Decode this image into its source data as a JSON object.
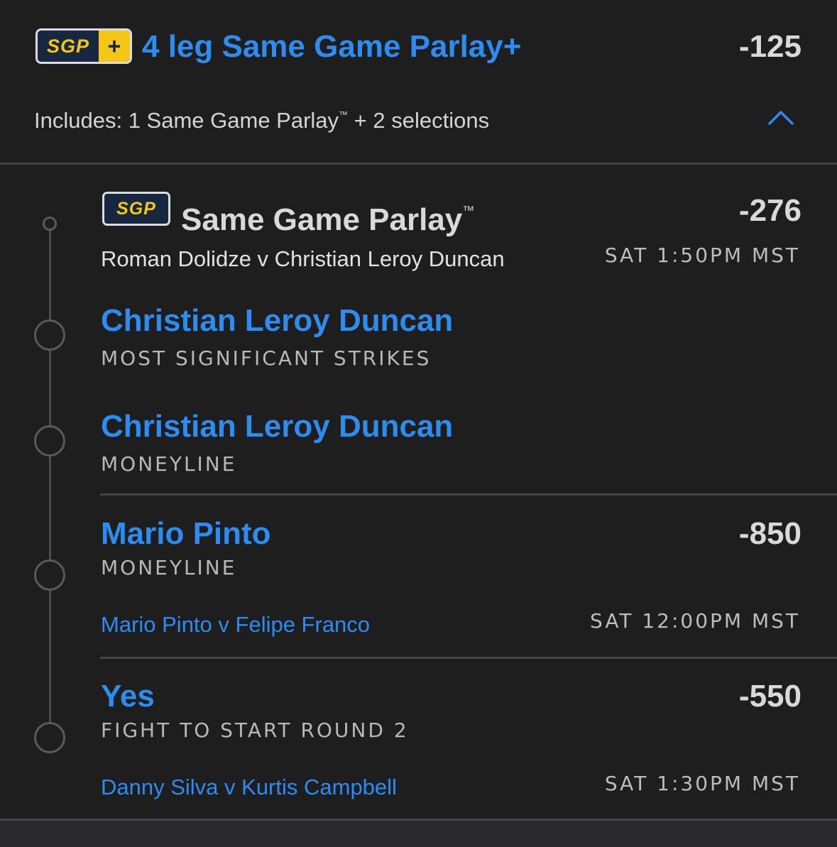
{
  "header": {
    "badge_text": "SGP",
    "badge_plus": "+",
    "title": "4 leg Same Game Parlay+",
    "odds": "-125",
    "includes_prefix": "Includes: 1 Same Game Parlay",
    "includes_tm": "™",
    "includes_suffix": " + 2 selections"
  },
  "sgp": {
    "badge_text": "SGP",
    "title": "Same Game Parlay",
    "tm": "™",
    "odds": "-276",
    "matchup": "Roman Dolidze v Christian Leroy Duncan",
    "time": "SAT 1:50PM MST",
    "legs": [
      {
        "name": "Christian Leroy Duncan",
        "market": "MOST SIGNIFICANT STRIKES"
      },
      {
        "name": "Christian Leroy Duncan",
        "market": "MONEYLINE"
      }
    ]
  },
  "selections": [
    {
      "name": "Mario Pinto",
      "market": "MONEYLINE",
      "odds": "-850",
      "matchup": "Mario Pinto v Felipe Franco",
      "time": "SAT 12:00PM MST"
    },
    {
      "name": "Yes",
      "market": "FIGHT TO START ROUND 2",
      "odds": "-550",
      "matchup": "Danny Silva v Kurtis Campbell",
      "time": "SAT 1:30PM MST"
    }
  ],
  "colors": {
    "background": "#1e1e1f",
    "accent_blue": "#2d8cf0",
    "badge_yellow": "#f5c518",
    "badge_navy": "#16273f"
  },
  "icons": {
    "collapse": "chevron-up-icon"
  }
}
